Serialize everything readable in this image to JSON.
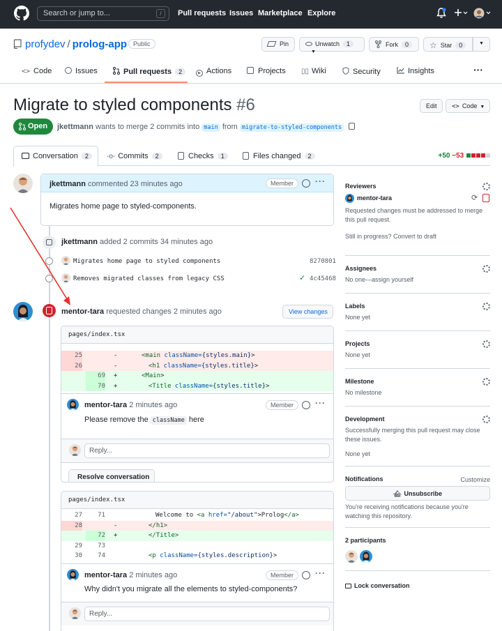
{
  "topbar": {
    "search_placeholder": "Search or jump to...",
    "search_shortcut": "/",
    "nav": [
      "Pull requests",
      "Issues",
      "Marketplace",
      "Explore"
    ]
  },
  "repo": {
    "owner": "profydev",
    "sep": "/",
    "name": "prolog-app",
    "visibility": "Public",
    "pin": "Pin",
    "unwatch": "Unwatch",
    "unwatch_count": "1",
    "fork": "Fork",
    "fork_count": "0",
    "star": "Star",
    "star_count": "0"
  },
  "tabs": {
    "code": "Code",
    "issues": "Issues",
    "pulls": "Pull requests",
    "pulls_count": "2",
    "actions": "Actions",
    "projects": "Projects",
    "wiki": "Wiki",
    "security": "Security",
    "insights": "Insights"
  },
  "pr": {
    "title": "Migrate to styled components",
    "number": "#6",
    "state": "Open",
    "author": "jkettmann",
    "meta_mid": "wants to merge 2 commits into",
    "base": "main",
    "from": "from",
    "head": "migrate-to-styled-components",
    "edit": "Edit",
    "code": "Code"
  },
  "prtabs": {
    "conversation": "Conversation",
    "conversation_count": "2",
    "commits": "Commits",
    "commits_count": "2",
    "checks": "Checks",
    "checks_count": "1",
    "files": "Files changed",
    "files_count": "2",
    "additions": "+50",
    "deletions": "−53"
  },
  "timeline": {
    "comment": {
      "author": "jkettmann",
      "action": "commented 23 minutes ago",
      "badge": "Member",
      "body": "Migrates home page to styled-components."
    },
    "commits_event": {
      "author": "jkettmann",
      "action": "added 2 commits 34 minutes ago",
      "commits": [
        {
          "message": "Migrates home page to styled components",
          "sha": "8270801"
        },
        {
          "message": "Removes migrated classes from legacy CSS",
          "sha": "4c45468"
        }
      ]
    },
    "review": {
      "author": "mentor-tara",
      "action": "requested changes 2 minutes ago",
      "view_changes": "View changes",
      "thread1": {
        "file": "pages/index.tsx",
        "lines": [
          {
            "old": "25",
            "new": "",
            "sign": "-",
            "type": "del"
          },
          {
            "old": "26",
            "new": "",
            "sign": "-",
            "type": "del"
          },
          {
            "old": "",
            "new": "69",
            "sign": "+",
            "type": "add"
          },
          {
            "old": "",
            "new": "70",
            "sign": "+",
            "type": "add"
          }
        ],
        "code": {
          "l1a": "<main",
          "l1b": " className=",
          "l1c": "{styles.main}",
          "l1d": ">",
          "l2a": "<h1",
          "l2b": " className=",
          "l2c": "{styles.title}",
          "l2d": ">",
          "l3a": "<Main",
          "l3b": ">",
          "l4a": "<Title",
          "l4b": " className=",
          "l4c": "{styles.title}",
          "l4d": ">"
        },
        "comment_author": "mentor-tara",
        "comment_time": "2 minutes ago",
        "comment_badge": "Member",
        "comment_pre": "Please remove the",
        "comment_code": "className",
        "comment_post": "here",
        "reply": "Reply...",
        "resolve": "Resolve conversation"
      },
      "thread2": {
        "file": "pages/index.tsx",
        "lines": [
          {
            "old": "27",
            "new": "71",
            "sign": "",
            "type": "ctx"
          },
          {
            "old": "28",
            "new": "",
            "sign": "-",
            "type": "del"
          },
          {
            "old": "",
            "new": "72",
            "sign": "+",
            "type": "add"
          },
          {
            "old": "29",
            "new": "73",
            "sign": "",
            "type": "ctx"
          },
          {
            "old": "30",
            "new": "74",
            "sign": "",
            "type": "ctx"
          }
        ],
        "code": {
          "l1a": "Welcome to ",
          "l1b": "<a",
          "l1c": " href=",
          "l1d": "\"/about\"",
          "l1e": ">Prolog",
          "l1f": "</a>",
          "l2": "</h1>",
          "l2b": ">",
          "l3": "</Title>",
          "l3b": ">",
          "l5a": "<p",
          "l5b": " className=",
          "l5c": "{styles.description}",
          "l5d": ">"
        },
        "comment_author": "mentor-tara",
        "comment_time": "2 minutes ago",
        "comment_badge": "Member",
        "comment_body": "Why didn't you migrate all the elements to styled-components?",
        "reply": "Reply..."
      }
    }
  },
  "sidebar": {
    "reviewers_h": "Reviewers",
    "reviewer": "mentor-tara",
    "reviewers_note": "Requested changes must be addressed to merge this pull request.",
    "draft_note": "Still in progress? Convert to draft",
    "assignees_h": "Assignees",
    "assignees_v": "No one—assign yourself",
    "labels_h": "Labels",
    "labels_v": "None yet",
    "projects_h": "Projects",
    "projects_v": "None yet",
    "milestone_h": "Milestone",
    "milestone_v": "No milestone",
    "development_h": "Development",
    "development_note": "Successfully merging this pull request may close these issues.",
    "development_v": "None yet",
    "notifications_h": "Notifications",
    "customize": "Customize",
    "unsubscribe": "Unsubscribe",
    "notifications_note": "You're receiving notifications because you're watching this repository.",
    "participants_h": "2 participants",
    "lock": "Lock conversation"
  },
  "colors": {
    "topbar": "#24292f",
    "accent": "#0969da",
    "open": "#1f883d",
    "danger": "#cf222e",
    "annotation_arrow": "#e5322d"
  }
}
